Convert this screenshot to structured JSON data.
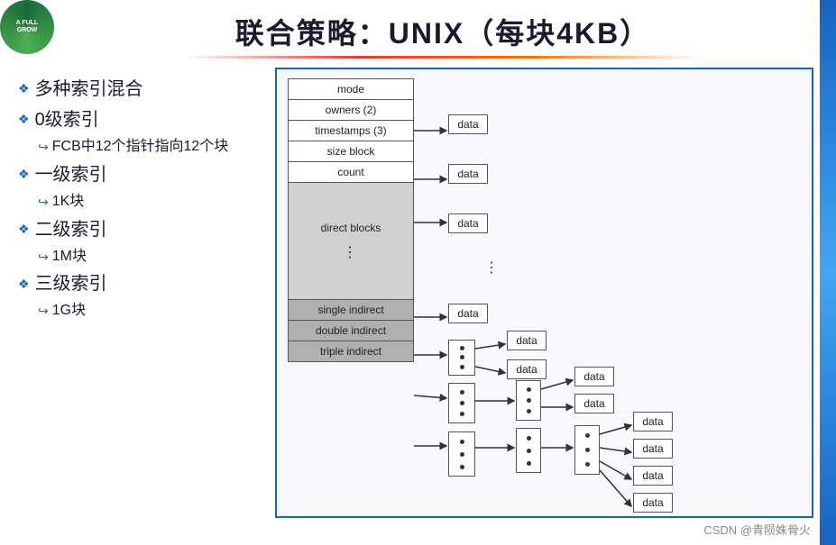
{
  "title": "联合策略：UNIX（每块4KB）",
  "left_panel": {
    "items": [
      {
        "type": "main",
        "text": "多种索引混合"
      },
      {
        "type": "main",
        "text": "0级索引"
      },
      {
        "type": "sub",
        "text": "FCB中12个指针指向12个块"
      },
      {
        "type": "main",
        "text": "一级索引"
      },
      {
        "type": "sub",
        "text": "1K块"
      },
      {
        "type": "main",
        "text": "二级索引"
      },
      {
        "type": "sub",
        "text": "1M块"
      },
      {
        "type": "main",
        "text": "三级索引"
      },
      {
        "type": "sub",
        "text": "1G块"
      }
    ]
  },
  "diagram": {
    "inode_rows": [
      {
        "label": "mode",
        "style": "normal"
      },
      {
        "label": "owners (2)",
        "style": "normal"
      },
      {
        "label": "timestamps (3)",
        "style": "normal"
      },
      {
        "label": "size block",
        "style": "normal"
      },
      {
        "label": "count",
        "style": "normal"
      },
      {
        "label": "direct blocks",
        "style": "gray",
        "tall": true
      },
      {
        "label": "single indirect",
        "style": "dark-gray"
      },
      {
        "label": "double indirect",
        "style": "dark-gray"
      },
      {
        "label": "triple indirect",
        "style": "dark-gray"
      }
    ],
    "data_labels": [
      "data",
      "data",
      "data",
      "data",
      "data",
      "data",
      "data",
      "data",
      "data",
      "data",
      "data"
    ]
  },
  "attribution": "CSDN @青陨姝骨火"
}
